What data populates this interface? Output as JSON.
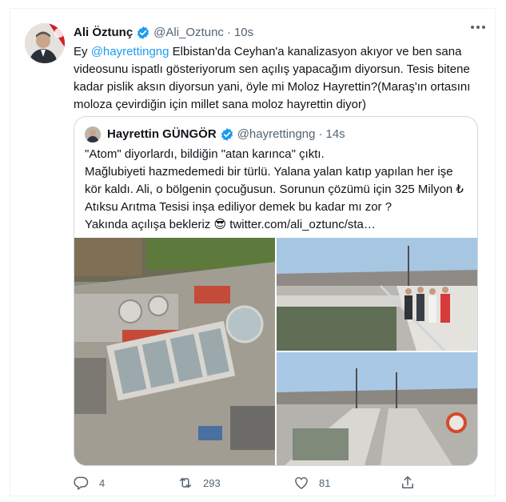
{
  "colors": {
    "accent": "#1d9bf0",
    "text": "#0f1419",
    "muted": "#536471",
    "border": "#cfd9de"
  },
  "tweet": {
    "author_name": "Ali Öztunç",
    "verified_icon": "verified-badge-icon",
    "handle": "@Ali_Oztunc",
    "separator": "·",
    "time": "10s",
    "more_icon": "more-options-icon",
    "text_prefix": "Ey ",
    "mention": "@hayrettingng",
    "text_body": " Elbistan'da Ceyhan'a kanalizasyon akıyor ve ben sana videosunu ispatlı gösteriyorum sen açılış yapacağım diyorsun. Tesis bitene kadar pislik aksın diyorsun yani, öyle mi Moloz Hayrettin?(Maraş'ın ortasını moloza çevirdiğin için millet sana moloz hayrettin diyor)"
  },
  "quote": {
    "author_name": "Hayrettin GÜNGÖR",
    "verified_icon": "verified-badge-icon",
    "handle": "@hayrettingng",
    "separator": "·",
    "time": "14s",
    "lines": [
      "\"Atom\" diyorlardı, bildiğin \"atan karınca\" çıktı.",
      "Mağlubiyeti hazmedemedi bir türlü. Yalana yalan katıp yapılan her işe",
      "kör kaldı. Ali, o bölgenin çocuğusun. Sorunun çözümü için 325 Milyon ₺",
      "Atıksu Arıtma Tesisi inşa ediliyor demek bu kadar mı zor ?"
    ],
    "last_line_text": "Yakında açılışa bekleriz ",
    "emoji": "😎",
    "link": "twitter.com/ali_oztunc/sta…"
  },
  "actions": {
    "reply_icon": "reply-icon",
    "reply_count": "4",
    "retweet_icon": "retweet-icon",
    "retweet_count": "293",
    "like_icon": "like-heart-icon",
    "like_count": "81",
    "share_icon": "share-icon"
  }
}
